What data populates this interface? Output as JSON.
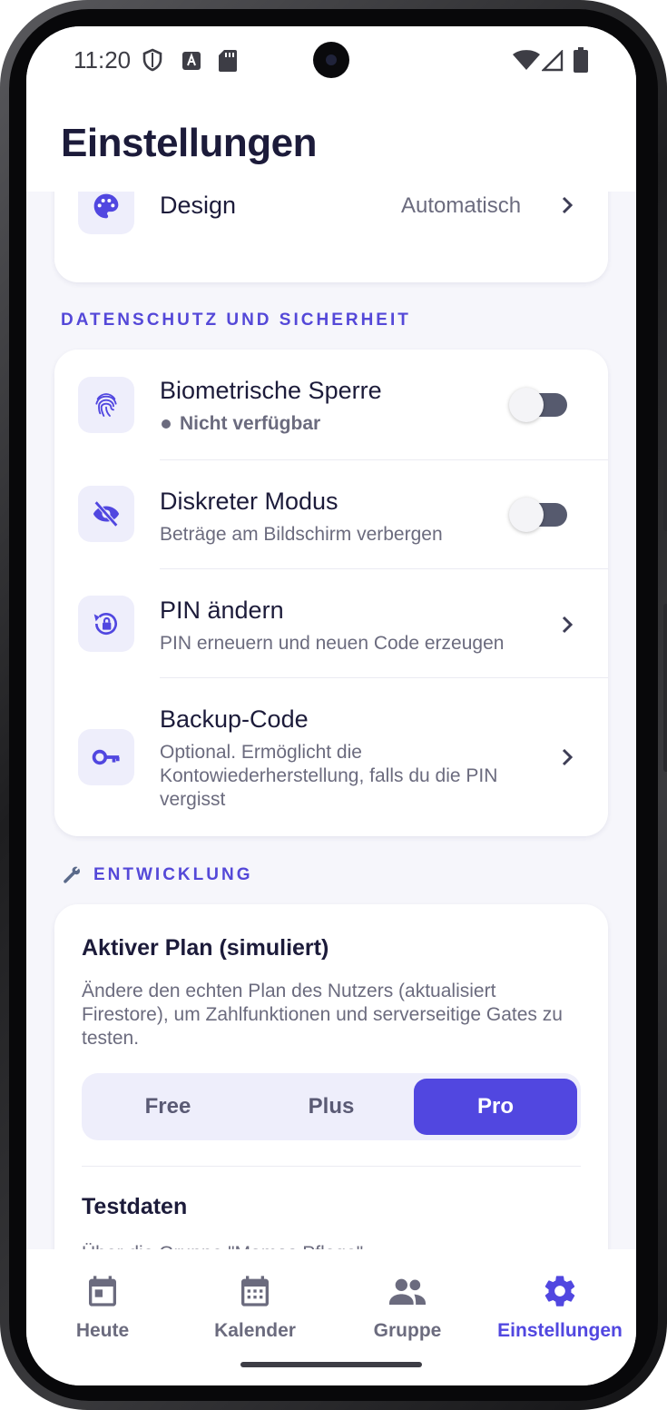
{
  "status": {
    "time": "11:20"
  },
  "header": {
    "title": "Einstellungen"
  },
  "design_row": {
    "label": "Design",
    "value": "Automatisch"
  },
  "privacy": {
    "section_label": "DATENSCHUTZ UND SICHERHEIT",
    "rows": [
      {
        "title": "Biometrische Sperre",
        "subtitle": "Nicht verfügbar",
        "control": "toggle-off",
        "icon": "fingerprint-icon"
      },
      {
        "title": "Diskreter Modus",
        "subtitle": "Beträge am Bildschirm verbergen",
        "control": "toggle-off",
        "icon": "eye-off-icon"
      },
      {
        "title": "PIN ändern",
        "subtitle": "PIN erneuern und neuen Code erzeugen",
        "control": "chevron",
        "icon": "lock-reset-icon"
      },
      {
        "title": "Backup-Code",
        "subtitle": "Optional. Ermöglicht die Kontowiederherstellung, falls du die PIN vergisst",
        "control": "chevron",
        "icon": "key-icon"
      }
    ]
  },
  "development": {
    "section_label": "ENTWICKLUNG",
    "plan_title": "Aktiver Plan (simuliert)",
    "plan_description": "Ändere den echten Plan des Nutzers (aktualisiert Firestore), um Zahlfunktionen und serverseitige Gates zu testen.",
    "plans": [
      "Free",
      "Plus",
      "Pro"
    ],
    "selected_plan": "Pro",
    "testdata_title": "Testdaten",
    "testdata_description": "Über die Gruppe \"Mamas Pflege\""
  },
  "nav": {
    "items": [
      {
        "label": "Heute",
        "icon": "calendar-today-icon"
      },
      {
        "label": "Kalender",
        "icon": "calendar-month-icon"
      },
      {
        "label": "Gruppe",
        "icon": "group-icon"
      },
      {
        "label": "Einstellungen",
        "icon": "gear-icon"
      }
    ],
    "active": "Einstellungen"
  },
  "colors": {
    "accent": "#5147e0",
    "title": "#1c1b3a",
    "subtle": "#6b6b7e",
    "background": "#f6f6fb"
  }
}
